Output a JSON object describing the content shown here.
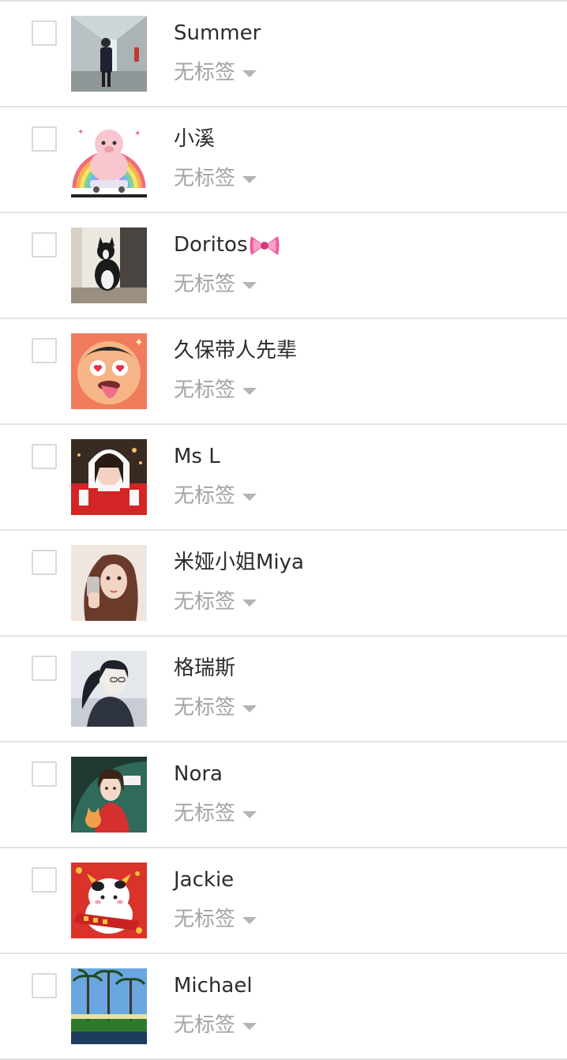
{
  "tag_placeholder": "无标签",
  "contacts": [
    {
      "name": "Summer",
      "tag": "无标签",
      "avatar": "photo-girl-corridor-icon"
    },
    {
      "name": "小溪",
      "tag": "无标签",
      "avatar": "alpaca-rainbow-icon"
    },
    {
      "name": "Doritos",
      "tag": "无标签",
      "avatar": "dog-photo-icon",
      "emoji": "ribbon-bow-icon"
    },
    {
      "name": "久保带人先辈",
      "tag": "无标签",
      "avatar": "cartoon-face-tongue-icon"
    },
    {
      "name": "Ms L",
      "tag": "无标签",
      "avatar": "santa-girl-photo-icon"
    },
    {
      "name": "米娅小姐Miya",
      "tag": "无标签",
      "avatar": "girl-selfie-photo-icon"
    },
    {
      "name": "格瑞斯",
      "tag": "无标签",
      "avatar": "anime-ponytail-icon"
    },
    {
      "name": "Nora",
      "tag": "无标签",
      "avatar": "cartoon-girl-cat-icon"
    },
    {
      "name": "Jackie",
      "tag": "无标签",
      "avatar": "cartoon-cow-new-year-icon"
    },
    {
      "name": "Michael",
      "tag": "无标签",
      "avatar": "palm-trees-photo-icon"
    }
  ],
  "watermark": {
    "line1": " ",
    "line2": " "
  },
  "colors": {
    "divider": "#e3e3e3",
    "name_text": "#2c2c2c",
    "tag_text": "#a3a3a3",
    "checkbox_border": "#d9d9d9"
  }
}
